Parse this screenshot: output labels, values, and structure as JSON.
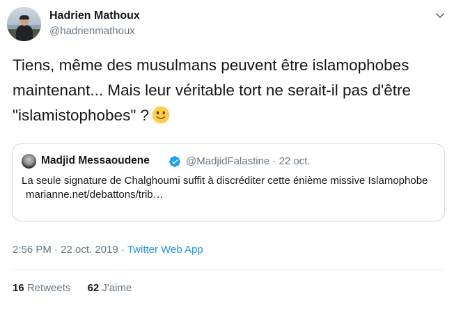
{
  "author": {
    "name": "Hadrien Mathoux",
    "handle": "@hadrienmathoux"
  },
  "tweet": {
    "text": "Tiens, même des musulmans peuvent être islamophobes maintenant... Mais leur véritable tort ne serait-il pas d'être \"islamistophobes\" ?",
    "emoji": "slightly-smiling-face"
  },
  "quote": {
    "name": "Madjid Messaoudene",
    "handle_date": "@MadjidFalastine · 22 oct.",
    "text": "La seule signature de Chalghoumi suffit à discréditer cette énième missive Islamophobe",
    "link": "marianne.net/debattons/trib…"
  },
  "meta": {
    "timestamp": "2:56 PM · 22 oct. 2019 · ",
    "app": "Twitter Web App"
  },
  "stats": {
    "retweets_count": "16",
    "retweets_label": "Retweets",
    "likes_count": "62",
    "likes_label": "J'aime"
  },
  "colors": {
    "link": "#1b95e0",
    "secondary_text": "#657786",
    "verified": "#1da1f2",
    "border": "#ccd6dd"
  }
}
